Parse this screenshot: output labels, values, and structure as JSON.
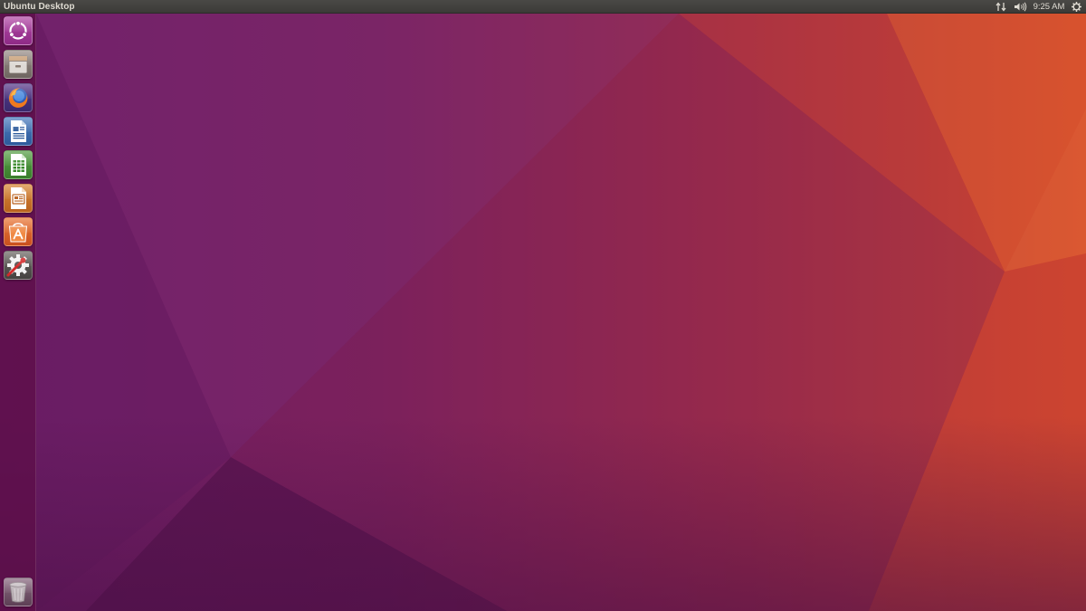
{
  "top_panel": {
    "window_title": "Ubuntu Desktop",
    "clock": "9:25 AM",
    "indicators": [
      "network-icon",
      "sound-icon",
      "session-gear-icon"
    ]
  },
  "launcher": {
    "items": [
      {
        "name": "dash-home",
        "icon": "ubuntu-logo-icon"
      },
      {
        "name": "files",
        "icon": "file-cabinet-icon"
      },
      {
        "name": "firefox",
        "icon": "firefox-icon"
      },
      {
        "name": "libreoffice-writer",
        "icon": "writer-document-icon"
      },
      {
        "name": "libreoffice-calc",
        "icon": "calc-spreadsheet-icon"
      },
      {
        "name": "libreoffice-impress",
        "icon": "impress-presentation-icon"
      },
      {
        "name": "ubuntu-software",
        "icon": "shopping-bag-icon"
      },
      {
        "name": "system-settings",
        "icon": "settings-wrench-gear-icon"
      }
    ],
    "trash": {
      "name": "trash",
      "icon": "trash-icon"
    }
  },
  "colors": {
    "panel_bg": "#3c3b37",
    "panel_text": "#dfdbd2",
    "launcher_bg": "#5c0e48",
    "wallpaper_purple": "#6e1f67",
    "wallpaper_orange": "#cf4a2a"
  }
}
